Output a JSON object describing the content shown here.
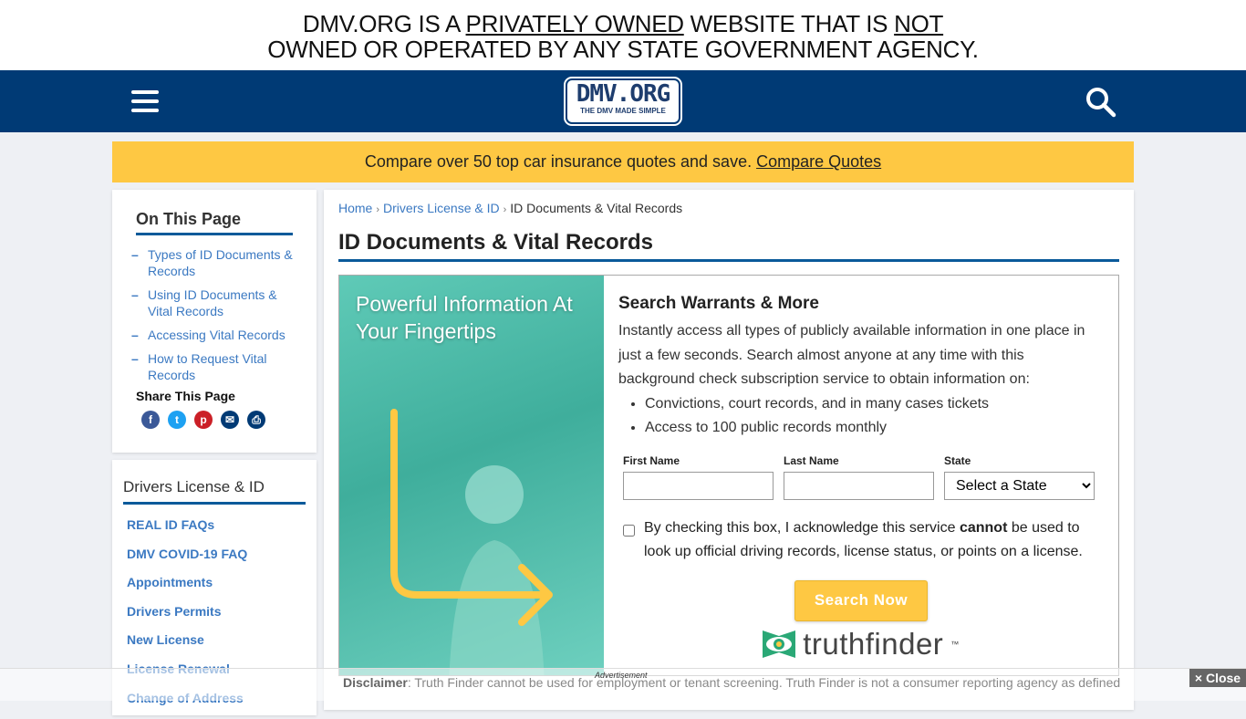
{
  "notice": {
    "l1a": "DMV.ORG IS A ",
    "l1b": "PRIVATELY OWNED",
    "l1c": " WEBSITE THAT IS ",
    "l1d": "NOT",
    "l2": "OWNED OR OPERATED BY ANY STATE GOVERNMENT AGENCY."
  },
  "nav": {
    "logo_main": "DMV.ORG",
    "logo_tag": "THE DMV MADE SIMPLE",
    "menu_icon": "hamburger-icon",
    "search_icon": "search-icon"
  },
  "promo": {
    "text": "Compare over 50 top car insurance quotes and save. ",
    "link": "Compare Quotes"
  },
  "toc": {
    "title": "On This Page",
    "items": [
      "Types of ID Documents & Records",
      "Using ID Documents & Vital Records",
      "Accessing Vital Records",
      "How to Request Vital Records"
    ],
    "share_title": "Share This Page",
    "share": [
      {
        "icon": "facebook-icon",
        "color": "#3b5998",
        "glyph": "f"
      },
      {
        "icon": "twitter-icon",
        "color": "#1da1f2",
        "glyph": "t"
      },
      {
        "icon": "pinterest-icon",
        "color": "#cb2027",
        "glyph": "p"
      },
      {
        "icon": "email-icon",
        "color": "#003a75",
        "glyph": "✉"
      },
      {
        "icon": "print-icon",
        "color": "#003a75",
        "glyph": "⎙"
      }
    ]
  },
  "section": {
    "title": "Drivers License & ID",
    "items": [
      "REAL ID FAQs",
      "DMV COVID-19 FAQ",
      "Appointments",
      "Drivers Permits",
      "New License",
      "License Renewal",
      "Change of Address"
    ]
  },
  "breadcrumb": {
    "home": "Home",
    "parent": "Drivers License & ID",
    "current": "ID Documents & Vital Records"
  },
  "page_title": "ID Documents & Vital Records",
  "ad": {
    "headline": "Powerful Information At Your Fingertips",
    "title": "Search Warrants & More",
    "desc": "Instantly access all types of publicly available information in one place in just a few seconds. Search almost anyone at any time with this background check subscription service to obtain information on:",
    "bullets": [
      "Convictions, court records, and in many cases tickets",
      "Access to 100 public records monthly"
    ],
    "first_name_label": "First Name",
    "first_name_value": "",
    "last_name_label": "Last Name",
    "last_name_value": "",
    "state_label": "State",
    "state_value": "Select a State",
    "checkbox_a": "By checking this box, I acknowledge this service ",
    "checkbox_b": "cannot",
    "checkbox_c": " be used to look up official driving records, license status, or points on a license.",
    "checkbox_checked": false,
    "button": "Search Now",
    "brand": "truthfinder",
    "brand_tm": "™"
  },
  "disclaimer": {
    "label": "Disclaimer",
    "text": ": Truth Finder cannot be used for employment or tenant screening. Truth Finder is not a consumer reporting agency as defined"
  },
  "adbar": {
    "label": "Advertisement",
    "close": "× Close"
  },
  "colors": {
    "navy": "#003a75",
    "yellow": "#fec843",
    "link": "#3b79c2"
  }
}
